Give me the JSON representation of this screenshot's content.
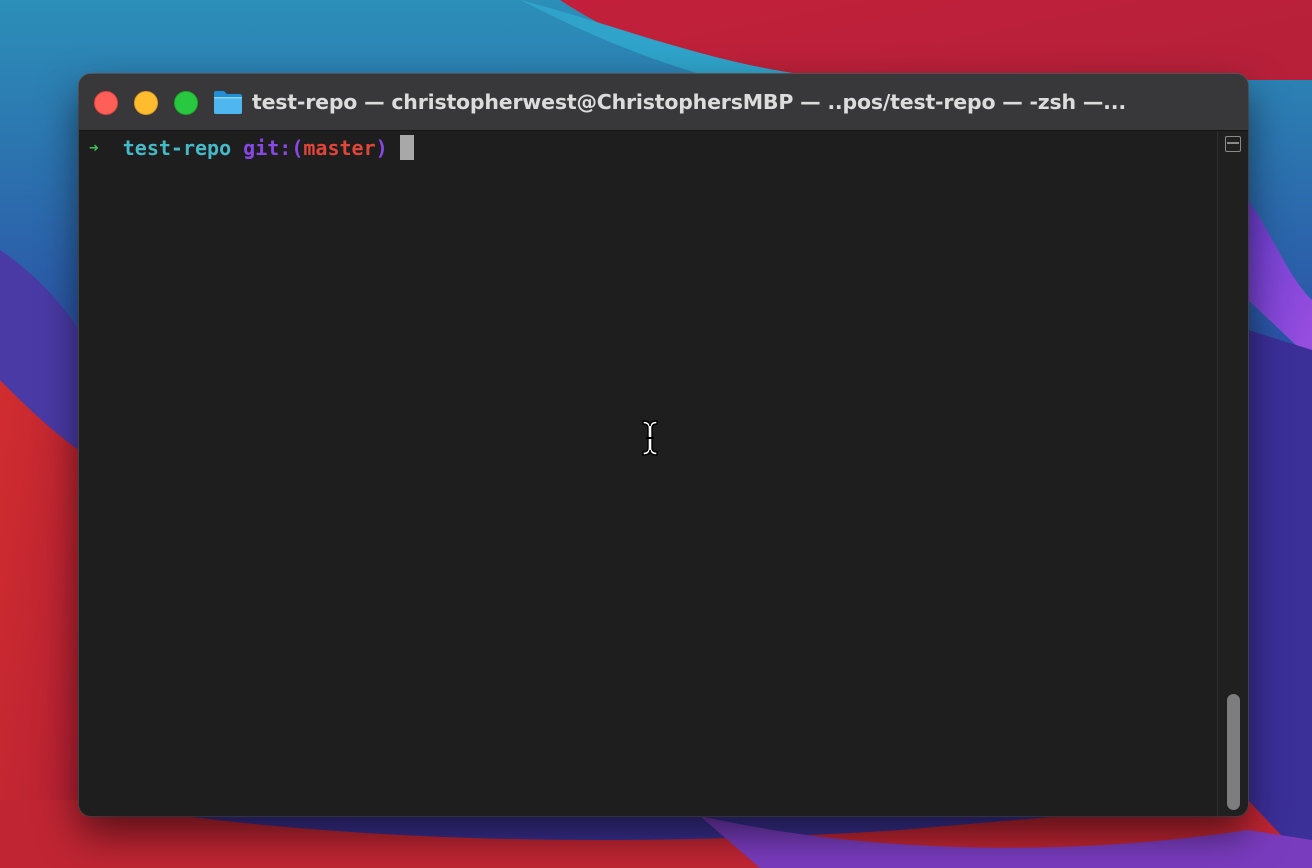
{
  "window": {
    "title": "test-repo — christopherwest@ChristophersMBP — ..pos/test-repo — -zsh —..."
  },
  "terminal": {
    "prompt_arrow": "➜",
    "directory": "test-repo",
    "git_label": "git:(",
    "branch": "master",
    "git_close": ")"
  },
  "icons": {
    "folder": "folder-icon",
    "split": "split-pane-icon",
    "cursor": "ibeam-cursor-icon"
  },
  "colors": {
    "prompt_arrow": "#3fbf54",
    "directory": "#45b9c7",
    "git": "#8a47e8",
    "branch": "#e0453a",
    "terminal_bg": "#1e1e1e",
    "titlebar_bg": "#38383a"
  }
}
